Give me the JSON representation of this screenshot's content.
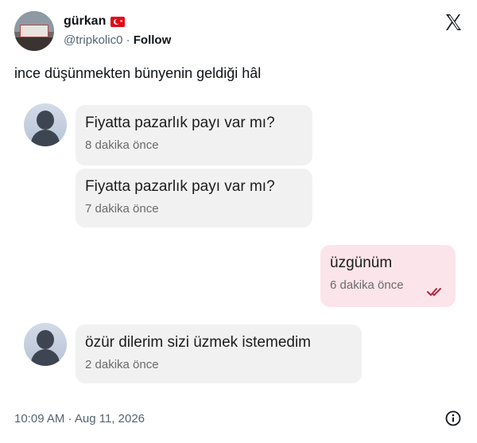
{
  "author": {
    "name": "gürkan",
    "flag_icon": "turkey-flag-icon",
    "handle": "@tripkolic0",
    "separator": "·",
    "follow_label": "Follow"
  },
  "tweet": {
    "text": "ince düşünmekten bünyenin geldiği hâl",
    "timestamp": "10:09 AM · Aug 11, 2026"
  },
  "messages": [
    {
      "text": "Fiyatta pazarlık payı var mı?",
      "time": "8 dakika önce",
      "sender": "other"
    },
    {
      "text": "Fiyatta pazarlık payı var mı?",
      "time": "7 dakika önce",
      "sender": "other"
    },
    {
      "text": "üzgünüm",
      "time": "6 dakika önce",
      "sender": "me"
    },
    {
      "text": "özür dilerim sizi üzmek istemedim",
      "time": "2 dakika önce",
      "sender": "other"
    }
  ],
  "colors": {
    "my_bubble": "#fbe4ea",
    "other_bubble": "#f1f1f1",
    "read_ticks": "#b5283f",
    "flag_red": "#e30a17"
  }
}
